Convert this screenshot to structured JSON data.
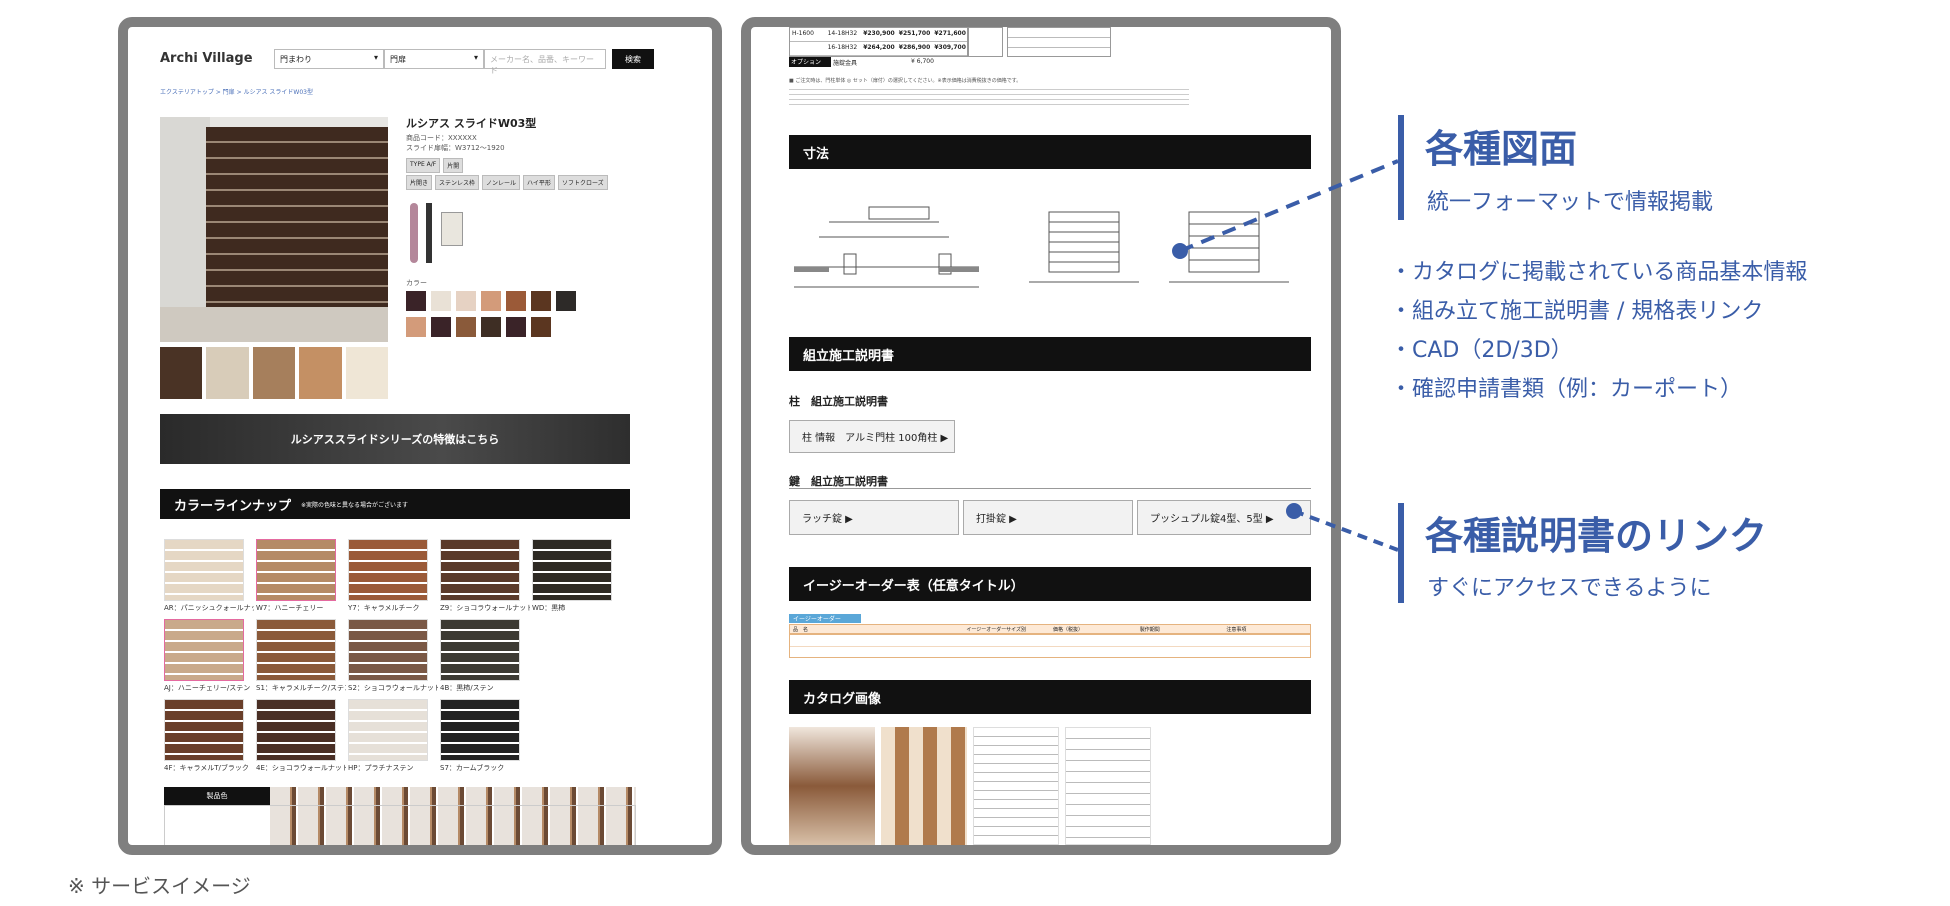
{
  "frame1": {
    "brand": "Archi Village",
    "search": {
      "select1": "門まわり",
      "select2": "門扉",
      "placeholder": "メーカー名、品番、キーワード",
      "button": "検索"
    },
    "breadcrumb": "エクステリアトップ > 門扉 > ルシアス スライドW03型",
    "product": {
      "title": "ルシアス スライドW03型",
      "meta1": "商品コード：XXXXXX",
      "meta2": "スライド扉幅：W3712～1920",
      "tags_row1": [
        "TYPE A/F",
        "片開"
      ],
      "tags_row2": [
        "片開き",
        "ステンレス枠",
        "ノンレール",
        "ハイ平形",
        "ソフトクローズ"
      ],
      "color_label": "カラー"
    },
    "swatches_row1": [
      "#3a2328",
      "#e9e1d6",
      "#e6d2c3",
      "#d39b7a",
      "#9b5a38",
      "#5b3620",
      "#2d2a28"
    ],
    "swatches_row2": [
      "#d39b7a",
      "#3a2328",
      "#8a5a3a",
      "#3e2e24",
      "#3a2328",
      "#5b3620"
    ],
    "banner": "ルシアススライドシリーズの特徴はこちら",
    "lineup": {
      "header": "カラーラインナップ",
      "header_note": "※実際の色味と異なる場合がございます",
      "items": [
        "AR：パニッシュクォールナット",
        "W7：ハニーチェリー",
        "Y7：キャラメルチーク",
        "Z9：ショコラウォールナット",
        "WD：黒柿",
        "AJ：ハニーチェリー/ステン",
        "S1：キャラメルチーク/ステン",
        "S2：ショコラウォールナット/ステン",
        "4B：黒柿/ステン",
        "4F：キャラメルT/ブラック",
        "4E：ショコラウォールナット/ブラック",
        "HP：プラチナステン",
        "S7：カームブラック"
      ],
      "item_colors": [
        "#e5d7c4",
        "#b58a66",
        "#9a5a38",
        "#5a3a2a",
        "#2e2a24",
        "#c9a98a",
        "#8a5a3a",
        "#7a5845",
        "#3c3a33",
        "#6a3f2a",
        "#4a2f25",
        "#e6e0d8",
        "#222"
      ]
    },
    "table_header": "製品色"
  },
  "frame2": {
    "price_rows": [
      [
        "H-1600",
        "14-18H32",
        "¥230,900",
        "¥251,700",
        "¥271,600"
      ],
      [
        "",
        "16-18H32",
        "¥264,200",
        "¥286,900",
        "¥309,700"
      ]
    ],
    "option_label": "オプション",
    "option_item": "施錠金具",
    "option_price": "¥ 6,700",
    "fine_print": "■ ご注文時は、門柱単体 ◎ セット（扉付）の選択してください。※表示価格は消費税抜きの価格です。",
    "section_dim": "寸法",
    "section_assembly": "組立施工説明書",
    "sub_pillar": "柱　組立施工説明書",
    "pillar_button": "柱 情報　アルミ門柱 100角柱 ▶",
    "sub_key": "鍵　組立施工説明書",
    "key_buttons": [
      "ラッチ錠 ▶",
      "打掛錠 ▶",
      "プッシュプル錠4型、5型 ▶"
    ],
    "section_easy": "イージーオーダー表（任意タイトル）",
    "easy_tab": "イージーオーダー",
    "easy_cols": [
      "品　名",
      "",
      "イージーオーダーサイズ別",
      "価格（税抜）",
      "製作期間",
      "注意事項"
    ],
    "section_catalog": "カタログ画像"
  },
  "callouts": {
    "c1_heading": "各種図面",
    "c1_sub": "統一フォーマットで情報掲載",
    "bullets": [
      "・カタログに掲載されている商品基本情報",
      "・組み立て施工説明書 / 規格表リンク",
      "・CAD（2D/3D）",
      "・確認申請書類（例：カーポート）"
    ],
    "c2_heading": "各種説明書のリンク",
    "c2_sub": "すぐにアクセスできるように"
  },
  "footnote": "※ サービスイメージ",
  "colors": {
    "accent": "#3a5da8",
    "frame": "#7f7f7f",
    "bar": "#111111"
  }
}
